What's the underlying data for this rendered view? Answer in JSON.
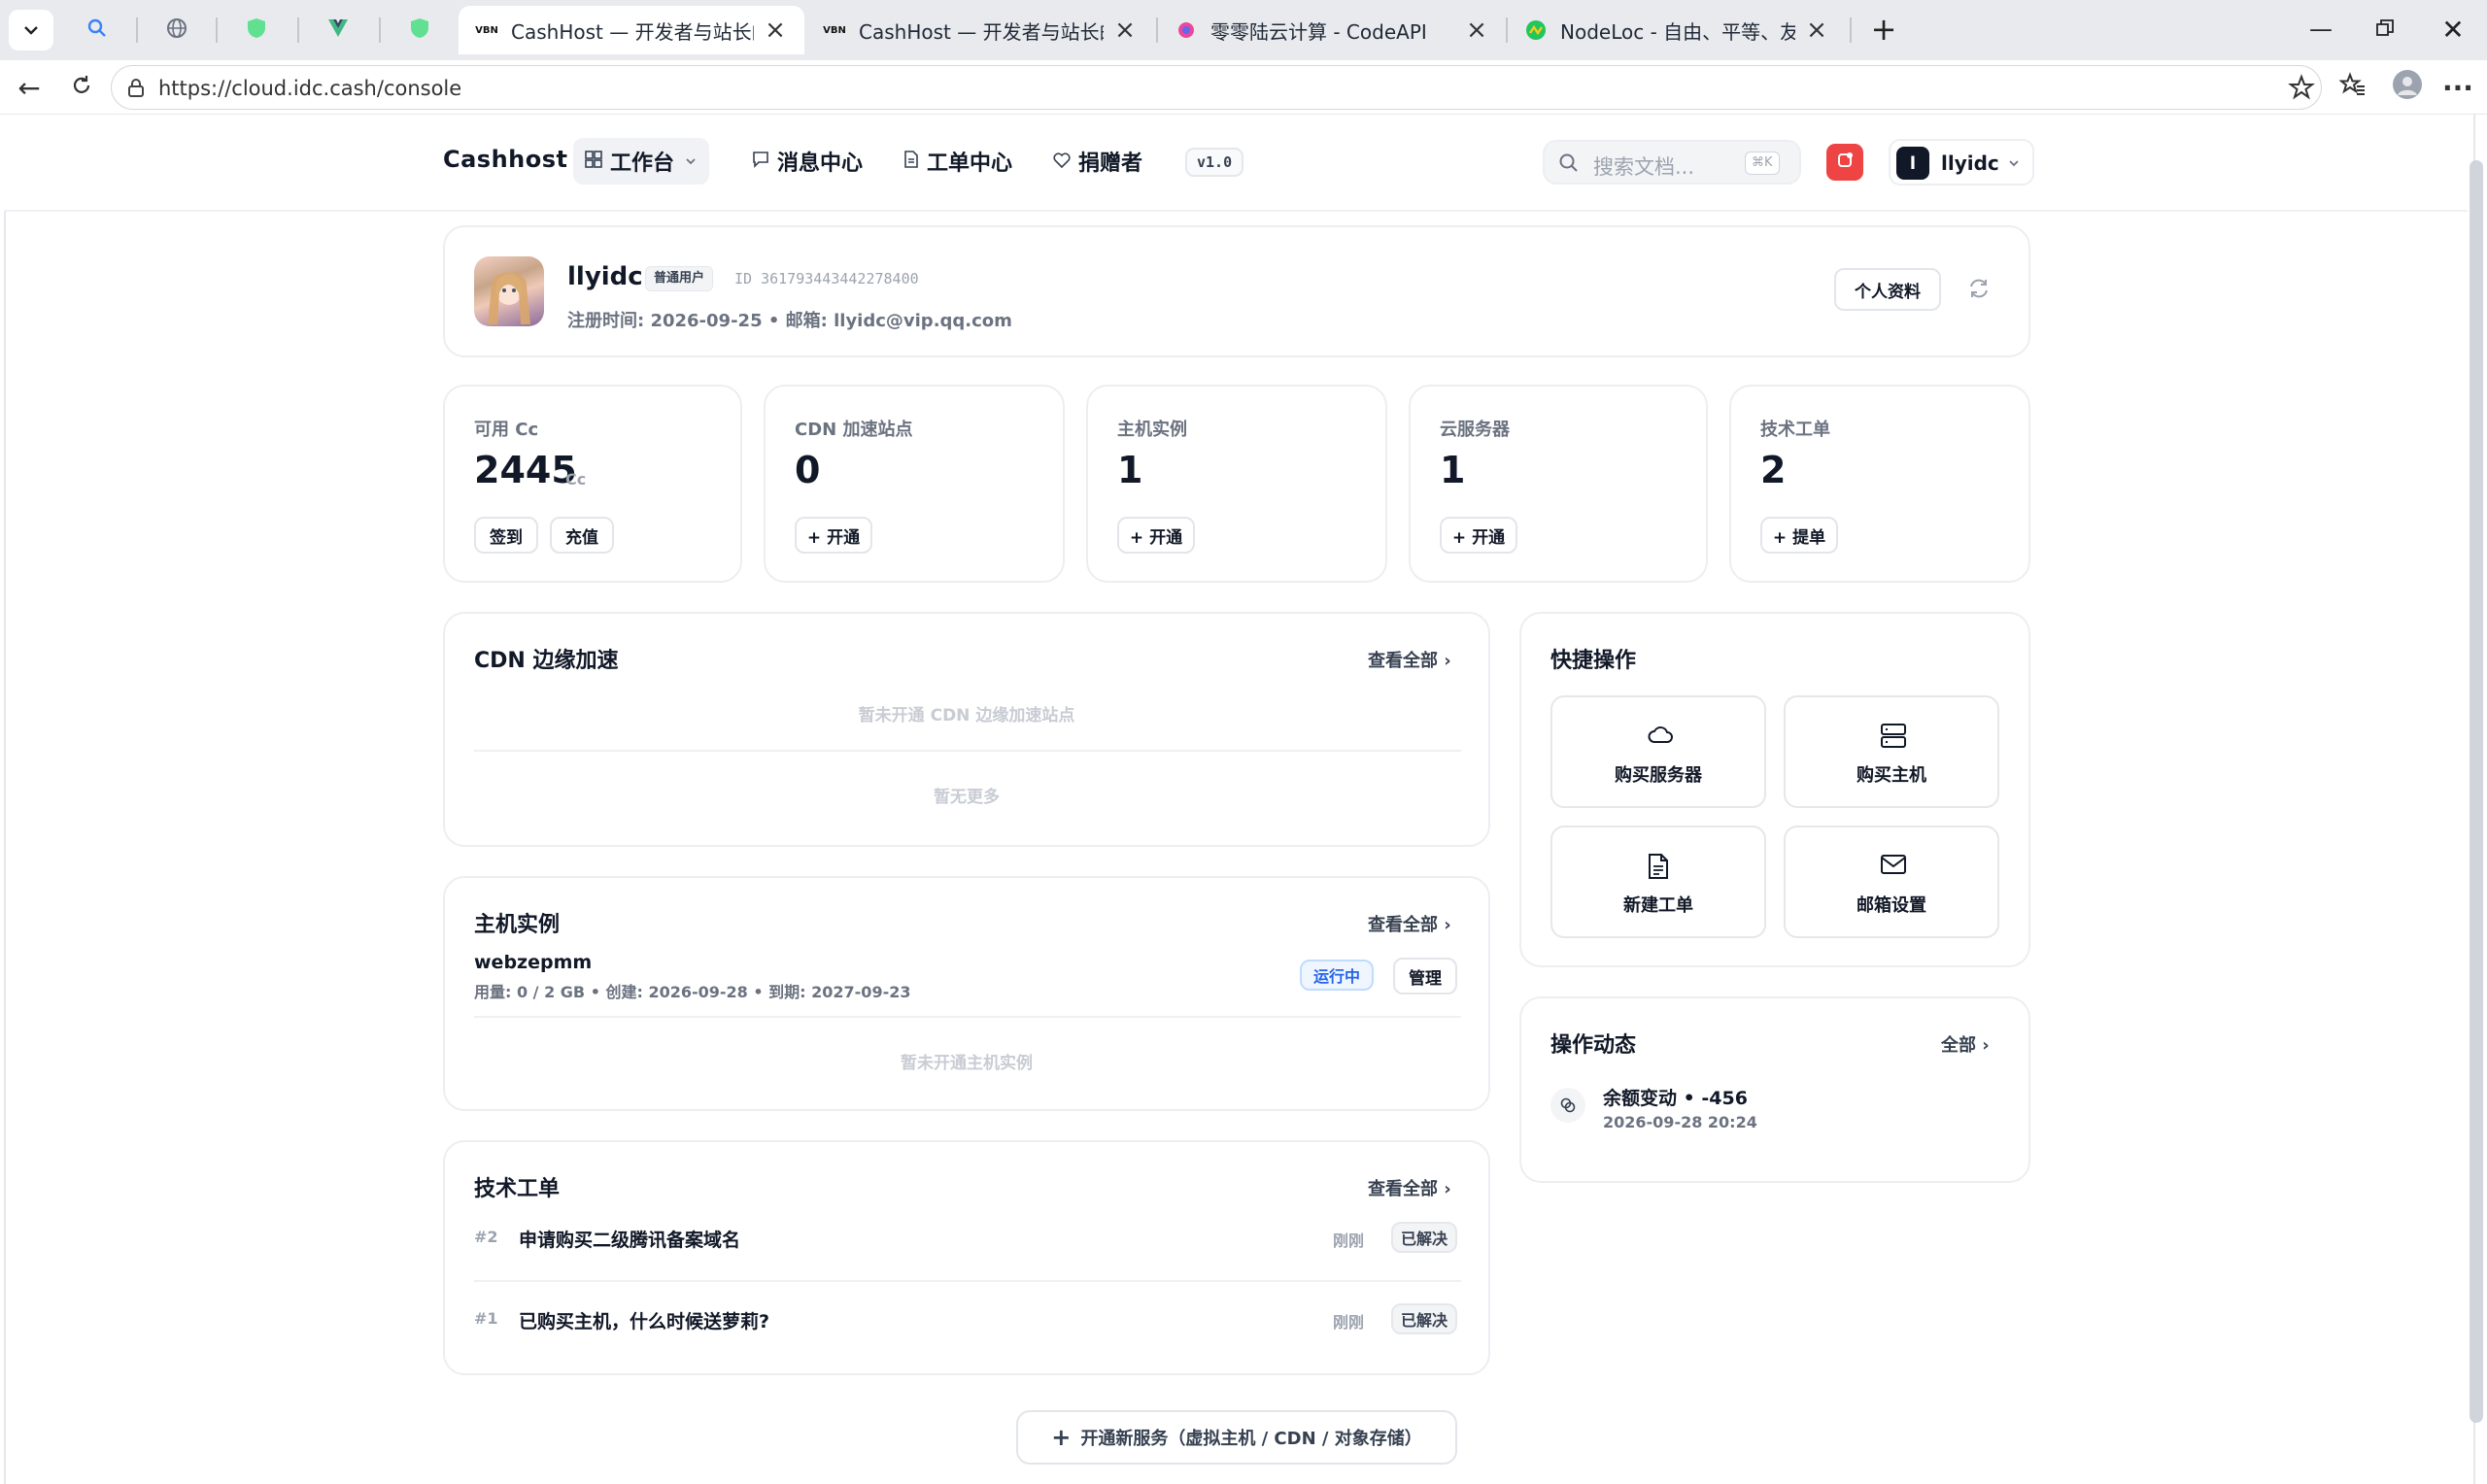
{
  "browser": {
    "tabs": [
      {
        "title": "CashHost — 开发者与站长的云托管",
        "active": true
      },
      {
        "title": "CashHost — 开发者与站长的云托管",
        "active": false
      },
      {
        "title": "零零陆云计算 - CodeAPI",
        "active": false
      },
      {
        "title": "NodeLoc - 自由、平等、友好、开放",
        "active": false
      }
    ],
    "url": "https://cloud.idc.cash/console"
  },
  "header": {
    "brand": "Cashhost",
    "nav": {
      "workspace": "工作台",
      "messages": "消息中心",
      "tickets": "工单中心",
      "donors": "捐赠者"
    },
    "version": "v1.0",
    "search_placeholder": "搜索文档...",
    "search_shortcut": "⌘K",
    "user_initial": "l",
    "username": "llyidc"
  },
  "profile": {
    "name": "llyidc",
    "role": "普通用户",
    "id_text": "ID 361793443442278400",
    "meta": "注册时间: 2026-09-25 • 邮箱: llyidc@vip.qq.com",
    "profile_button": "个人资料"
  },
  "stats": [
    {
      "label": "可用 Cc",
      "value": "2445",
      "unit": "Cc",
      "buttons": [
        "签到",
        "充值"
      ]
    },
    {
      "label": "CDN 加速站点",
      "value": "0",
      "buttons": [
        "+ 开通"
      ]
    },
    {
      "label": "主机实例",
      "value": "1",
      "buttons": [
        "+ 开通"
      ]
    },
    {
      "label": "云服务器",
      "value": "1",
      "buttons": [
        "+ 开通"
      ]
    },
    {
      "label": "技术工单",
      "value": "2",
      "buttons": [
        "+ 提单"
      ]
    }
  ],
  "cdn": {
    "title": "CDN 边缘加速",
    "view_all": "查看全部",
    "empty": "暂未开通 CDN 边缘加速站点",
    "no_more": "暂无更多"
  },
  "hosts": {
    "title": "主机实例",
    "view_all": "查看全部",
    "item": {
      "name": "webzepmm",
      "meta": "用量: 0 / 2 GB • 创建: 2026-09-28 • 到期: 2027-09-23",
      "status": "运行中",
      "manage": "管理"
    },
    "empty": "暂未开通主机实例"
  },
  "tickets": {
    "title": "技术工单",
    "view_all": "查看全部",
    "items": [
      {
        "no": "#2",
        "title": "申请购买二级腾讯备案域名",
        "time": "刚刚",
        "status": "已解决"
      },
      {
        "no": "#1",
        "title": "已购买主机，什么时候送萝莉?",
        "time": "刚刚",
        "status": "已解决"
      }
    ]
  },
  "quick_actions": {
    "title": "快捷操作",
    "items": [
      {
        "label": "购买服务器",
        "icon": "cloud-icon"
      },
      {
        "label": "购买主机",
        "icon": "server-icon"
      },
      {
        "label": "新建工单",
        "icon": "document-icon"
      },
      {
        "label": "邮箱设置",
        "icon": "mail-icon"
      }
    ]
  },
  "activity": {
    "title": "操作动态",
    "view_all": "全部",
    "item": {
      "title": "余额变动 • -456",
      "time": "2026-09-28 20:24"
    }
  },
  "footer_button": "开通新服务（虚拟主机 / CDN / 对象存储）",
  "colors": {
    "accent_blue": "#2563eb",
    "status_bg": "#eff6ff",
    "notify_red": "#ef4444",
    "user_dark": "#111827"
  }
}
